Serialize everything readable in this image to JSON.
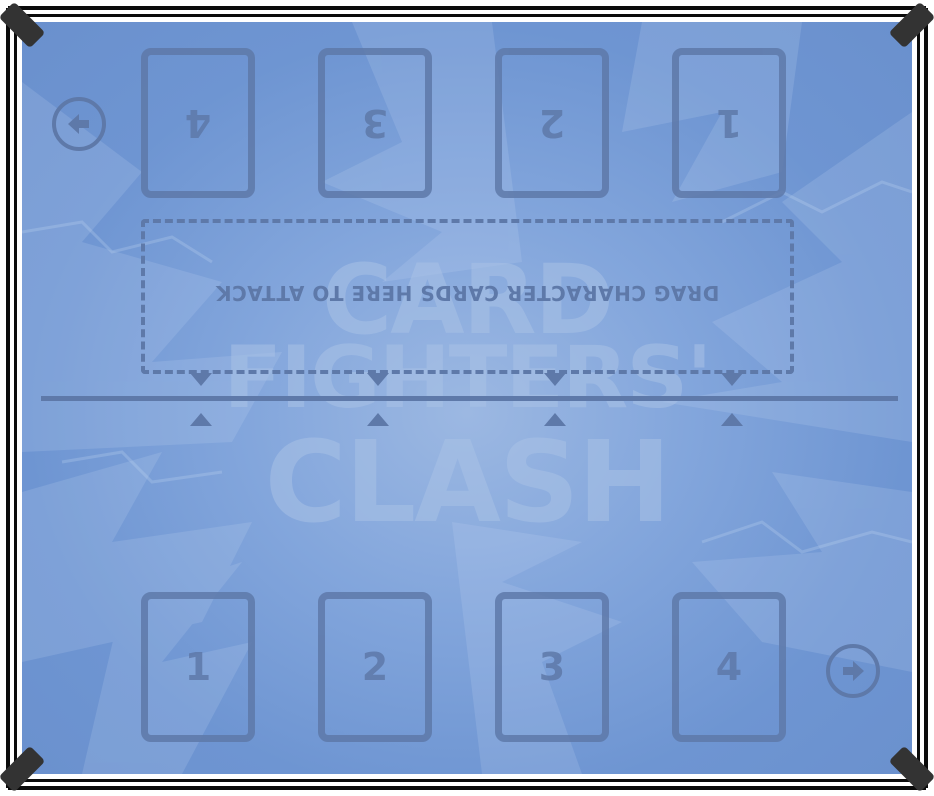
{
  "board": {
    "dropzone_label": "DRAG CHARACTER CARDS HERE TO ATTACK",
    "logo": [
      "CARD",
      "FIGHTERS'",
      "CLASH"
    ],
    "opponent_slots": [
      "4",
      "3",
      "2",
      "1"
    ],
    "player_slots": [
      "1",
      "2",
      "3",
      "4"
    ]
  },
  "icons": {
    "prev": "arrow-left-icon",
    "next": "arrow-right-icon"
  },
  "colors": {
    "mat": "#7a9ed6",
    "outline": "#5e79a9",
    "ropes": "#0b0b0b",
    "posts": "#333333"
  }
}
